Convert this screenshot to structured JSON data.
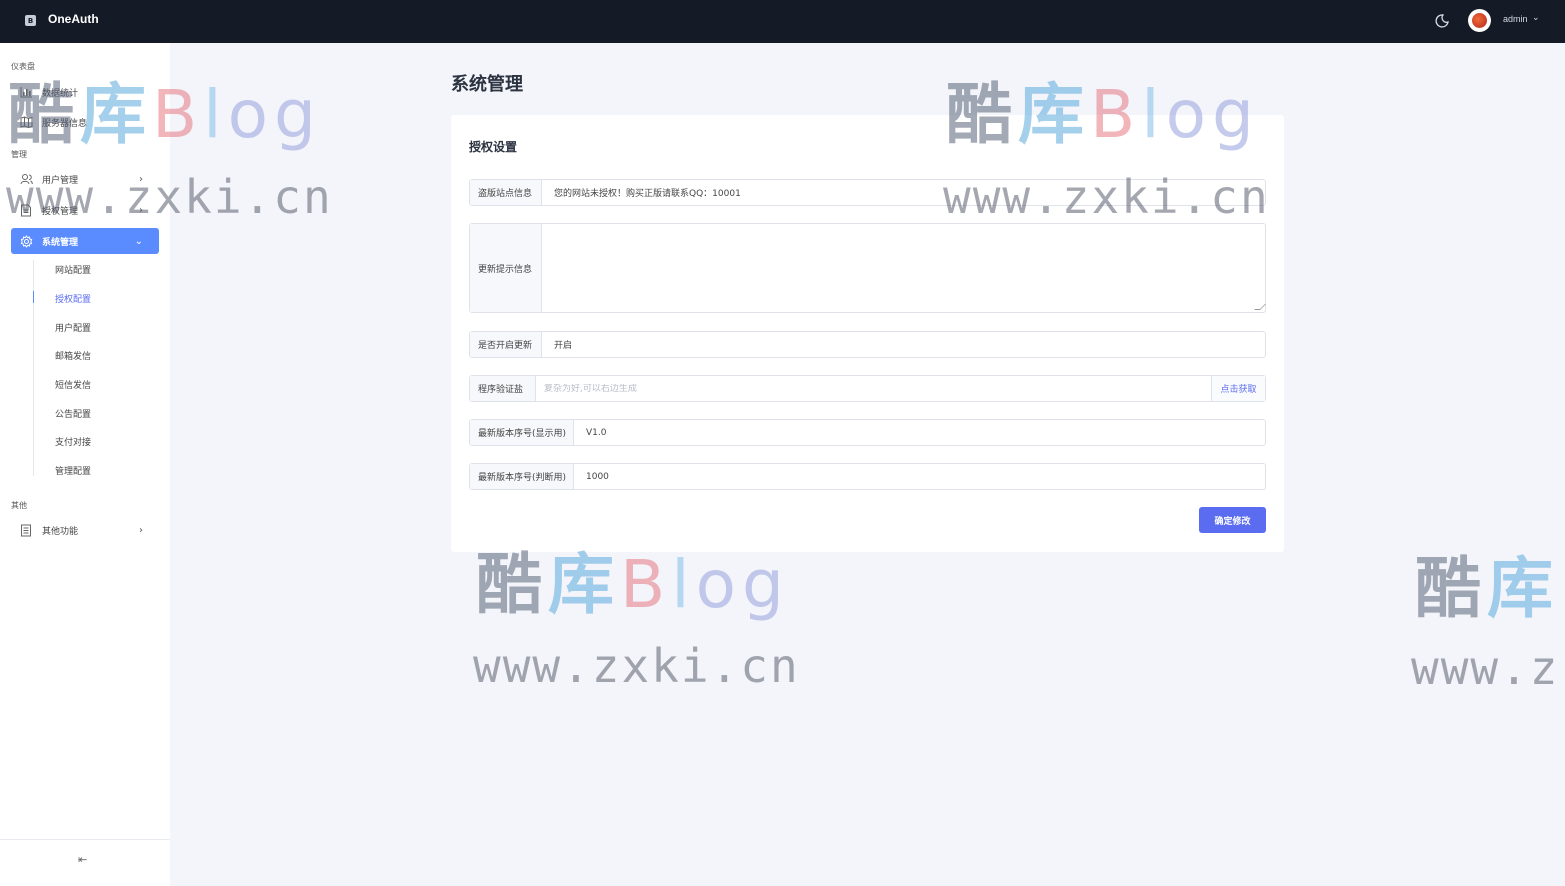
{
  "app": {
    "brand": "OneAuth",
    "logo_glyph": "B",
    "user": "admin"
  },
  "sidebar": {
    "sections": [
      {
        "title": "仪表盘"
      },
      {
        "title": "管理"
      },
      {
        "title": "其他"
      }
    ],
    "items": [
      {
        "label": "数据统计",
        "icon": "chart-icon"
      },
      {
        "label": "服务器信息",
        "icon": "map-icon"
      },
      {
        "label": "用户管理",
        "icon": "users-icon"
      },
      {
        "label": "授权管理",
        "icon": "document-icon"
      },
      {
        "label": "系统管理",
        "icon": "gear-icon"
      },
      {
        "label": "其他功能",
        "icon": "list-icon"
      }
    ],
    "sub_items": [
      "网站配置",
      "授权配置",
      "用户配置",
      "邮箱发信",
      "短信发信",
      "公告配置",
      "支付对接",
      "管理配置"
    ],
    "collapse_glyph": "⇤"
  },
  "main": {
    "page_title": "系统管理",
    "card_title": "授权设置",
    "fields": {
      "pirate_info": {
        "label": "盗版站点信息",
        "value": "您的网站未授权！购买正版请联系QQ：10001"
      },
      "update_tip": {
        "label": "更新提示信息",
        "value": ""
      },
      "update_enabled": {
        "label": "是否开启更新",
        "value": "开启"
      },
      "program_key": {
        "label": "程序验证盐",
        "placeholder": "复杂为好,可以右边生成",
        "append": "点击获取"
      },
      "version_display": {
        "label": "最新版本序号(显示用)",
        "value": "V1.0"
      },
      "version_judge": {
        "label": "最新版本序号(判断用)",
        "value": "1000"
      }
    },
    "submit_label": "确定修改"
  },
  "watermark": {
    "cn_1": "酷",
    "cn_2": "库",
    "b_1": "B",
    "b_2": "l",
    "b_3": "og",
    "url": "www.zxki.cn",
    "url_partial": "www.z"
  },
  "colors": {
    "topbar": "#141a26",
    "accent": "#5b8cff",
    "primary_button": "#5b6cf0"
  }
}
